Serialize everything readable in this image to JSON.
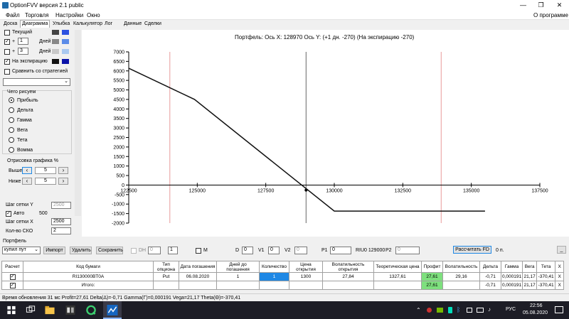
{
  "window": {
    "title": "OptionFVV версия 2.1 public",
    "min": "—",
    "restore": "❐",
    "close": "✕"
  },
  "menu": {
    "items": [
      "Файл",
      "Торговля",
      "Настройки",
      "Окно"
    ],
    "about": "О программе"
  },
  "tabs": [
    "Доска",
    "Диаграмма",
    "Улыбка",
    "Калькулятор",
    "Лог",
    "Данные",
    "Сделки"
  ],
  "left": {
    "current": "Текущий",
    "plus1": "+",
    "plus1_val": "1",
    "plus1_unit": "Дней",
    "plus2": "+",
    "plus2_val": "3",
    "plus2_unit": "Дней",
    "expiry": "На экспирацию",
    "compare": "Сравнить со стратегией",
    "what_title": "Чего рисуем",
    "modes": [
      "Прибыль",
      "Дельта",
      "Гамма",
      "Вега",
      "Тета",
      "Вомма"
    ],
    "draw_title": "Отрисовка графика %",
    "above": "Выше",
    "above_val": "5",
    "below": "Ниже",
    "below_val": "5",
    "grid_y": "Шаг сетки Y",
    "grid_y_val": "2500",
    "auto": "Авто",
    "auto_val": "500",
    "grid_x": "Шаг сетки X",
    "grid_x_val": "2500",
    "sko": "Кол-во СКО",
    "sko_val": "2"
  },
  "chart_data": {
    "type": "line",
    "title": "Портфель: Ось X: 128970 Ось Y: (+1 дн. -270) (На экспирацию -270)",
    "xlim": [
      122500,
      137500
    ],
    "ylim": [
      -2000,
      7000
    ],
    "x_ticks": [
      122500,
      125000,
      127500,
      130000,
      132500,
      135000,
      137500
    ],
    "y_ticks": [
      7000,
      6500,
      6000,
      5500,
      5000,
      4500,
      4000,
      3500,
      3000,
      2500,
      2000,
      1500,
      1000,
      500,
      0,
      -500,
      -1000,
      -1500,
      -2000
    ],
    "series": [
      {
        "x": [
          122500,
          124900,
          130000,
          135500
        ],
        "y": [
          6140,
          4500,
          -1370,
          -1370
        ]
      }
    ],
    "vlines_red": [
      124000,
      133900
    ],
    "vline_current": 128970,
    "marker": [
      128970,
      -270
    ]
  },
  "bottom": {
    "portfolio": "Портфель",
    "portfolio_select": "купил пут",
    "import": "Импорт",
    "delete": "Удалить",
    "save": "Сохранить",
    "dh": "DH",
    "dh_a": "0",
    "dh_b": "1",
    "m": "M",
    "d": "D",
    "d_val": "0",
    "v1": "V1",
    "v1_val": "0",
    "v2": "V2",
    "v2_val": "0",
    "p1": "P1",
    "p1_val": "0",
    "riu": "RIU0 129000",
    "p2": "P2",
    "p2_val": "0",
    "calc_fd": "Рассчитать FD",
    "zero_p": "0 п.",
    "underscore": "_"
  },
  "table": {
    "headers": [
      "Расчет",
      "Код бумаги",
      "Тип опциона",
      "Дата погашения",
      "Дней до погашения",
      "Количество",
      "Цена открытия",
      "Волатильность открытия",
      "Теоретическая цена",
      "Профит",
      "Волатильность",
      "Дельта",
      "Гамма",
      "Вега",
      "Тета",
      "X"
    ],
    "row": [
      "",
      "RI130000BT0A",
      "Put",
      "06.08.2020",
      "1",
      "1",
      "1300",
      "27,84",
      "1327,61",
      "27,61",
      "29,16",
      "-0,71",
      "0,000191",
      "21,17",
      "-370,41",
      "X"
    ],
    "total": [
      "",
      "Итого:",
      "",
      "",
      "",
      "",
      "",
      "",
      "",
      "27,61",
      "",
      "-0,71",
      "0,000191",
      "21,17",
      "-370,41",
      "X"
    ]
  },
  "status": "Время обновления 31 мс  Profit=27,61 Delta(Δ)=-0,71 Gamma(Γ)=0,000191 Vega=21,17 Theta(Θ)=-370,41",
  "taskbar": {
    "lang": "РУС",
    "time": "22:56",
    "date": "05.08.2020"
  },
  "colors": {
    "accent": "#1e88e5",
    "profit_green": "#7ee07e",
    "red_line": "#e89a9a"
  }
}
